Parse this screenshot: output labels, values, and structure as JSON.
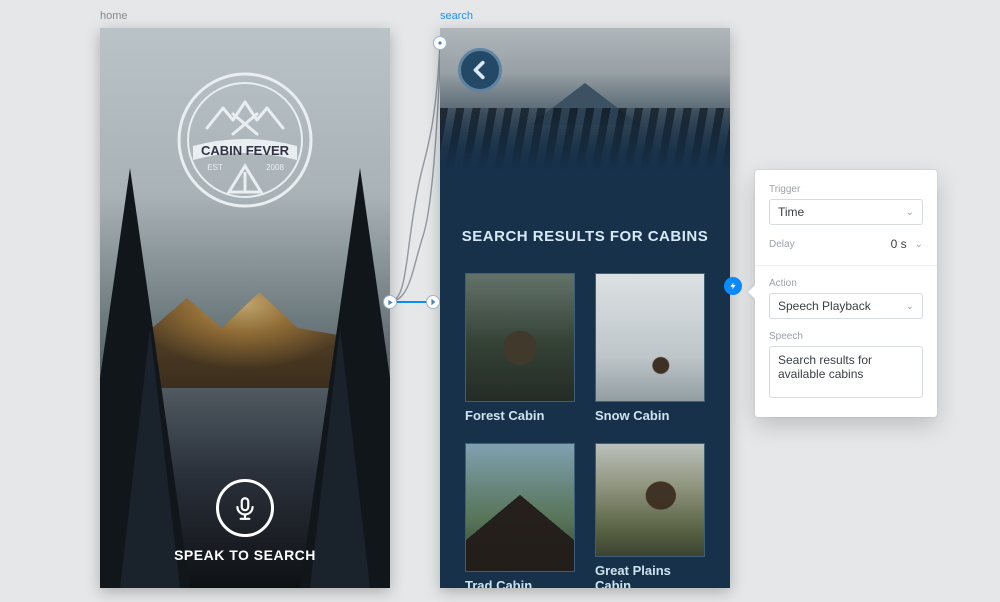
{
  "pages": {
    "home": {
      "label": "home"
    },
    "search": {
      "label": "search"
    }
  },
  "home": {
    "logo_brand": "CABIN FEVER",
    "logo_est": "EST",
    "logo_year": "2008",
    "speak_label": "SPEAK TO SEARCH"
  },
  "search": {
    "heading": "SEARCH RESULTS FOR CABINS",
    "results": [
      {
        "label": "Forest Cabin"
      },
      {
        "label": "Snow Cabin"
      },
      {
        "label": "Trad Cabin"
      },
      {
        "label": "Great Plains Cabin"
      }
    ]
  },
  "panel": {
    "trigger_label": "Trigger",
    "trigger_value": "Time",
    "delay_label": "Delay",
    "delay_value": "0 s",
    "action_label": "Action",
    "action_value": "Speech Playback",
    "speech_label": "Speech",
    "speech_value": "Search results for available cabins"
  }
}
